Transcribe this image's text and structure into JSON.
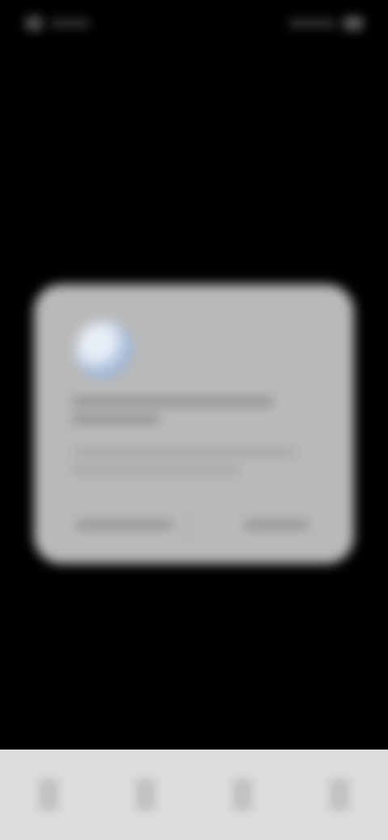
{
  "status_bar": {
    "left_icon": "status-indicator",
    "right_icon": "battery-icon"
  },
  "dialog": {
    "icon": "app-icon",
    "title": "",
    "body": "",
    "buttons": [
      {
        "label": ""
      },
      {
        "label": ""
      }
    ]
  },
  "bottom_nav": {
    "items": [
      {
        "icon": "nav-icon-1"
      },
      {
        "icon": "nav-icon-2"
      },
      {
        "icon": "nav-icon-3"
      },
      {
        "icon": "nav-icon-4"
      }
    ]
  },
  "colors": {
    "background": "#000000",
    "dialog": "#b9b9b9",
    "bottom_nav": "#dcdcdc",
    "accent_icon": "#9fb6d6"
  }
}
